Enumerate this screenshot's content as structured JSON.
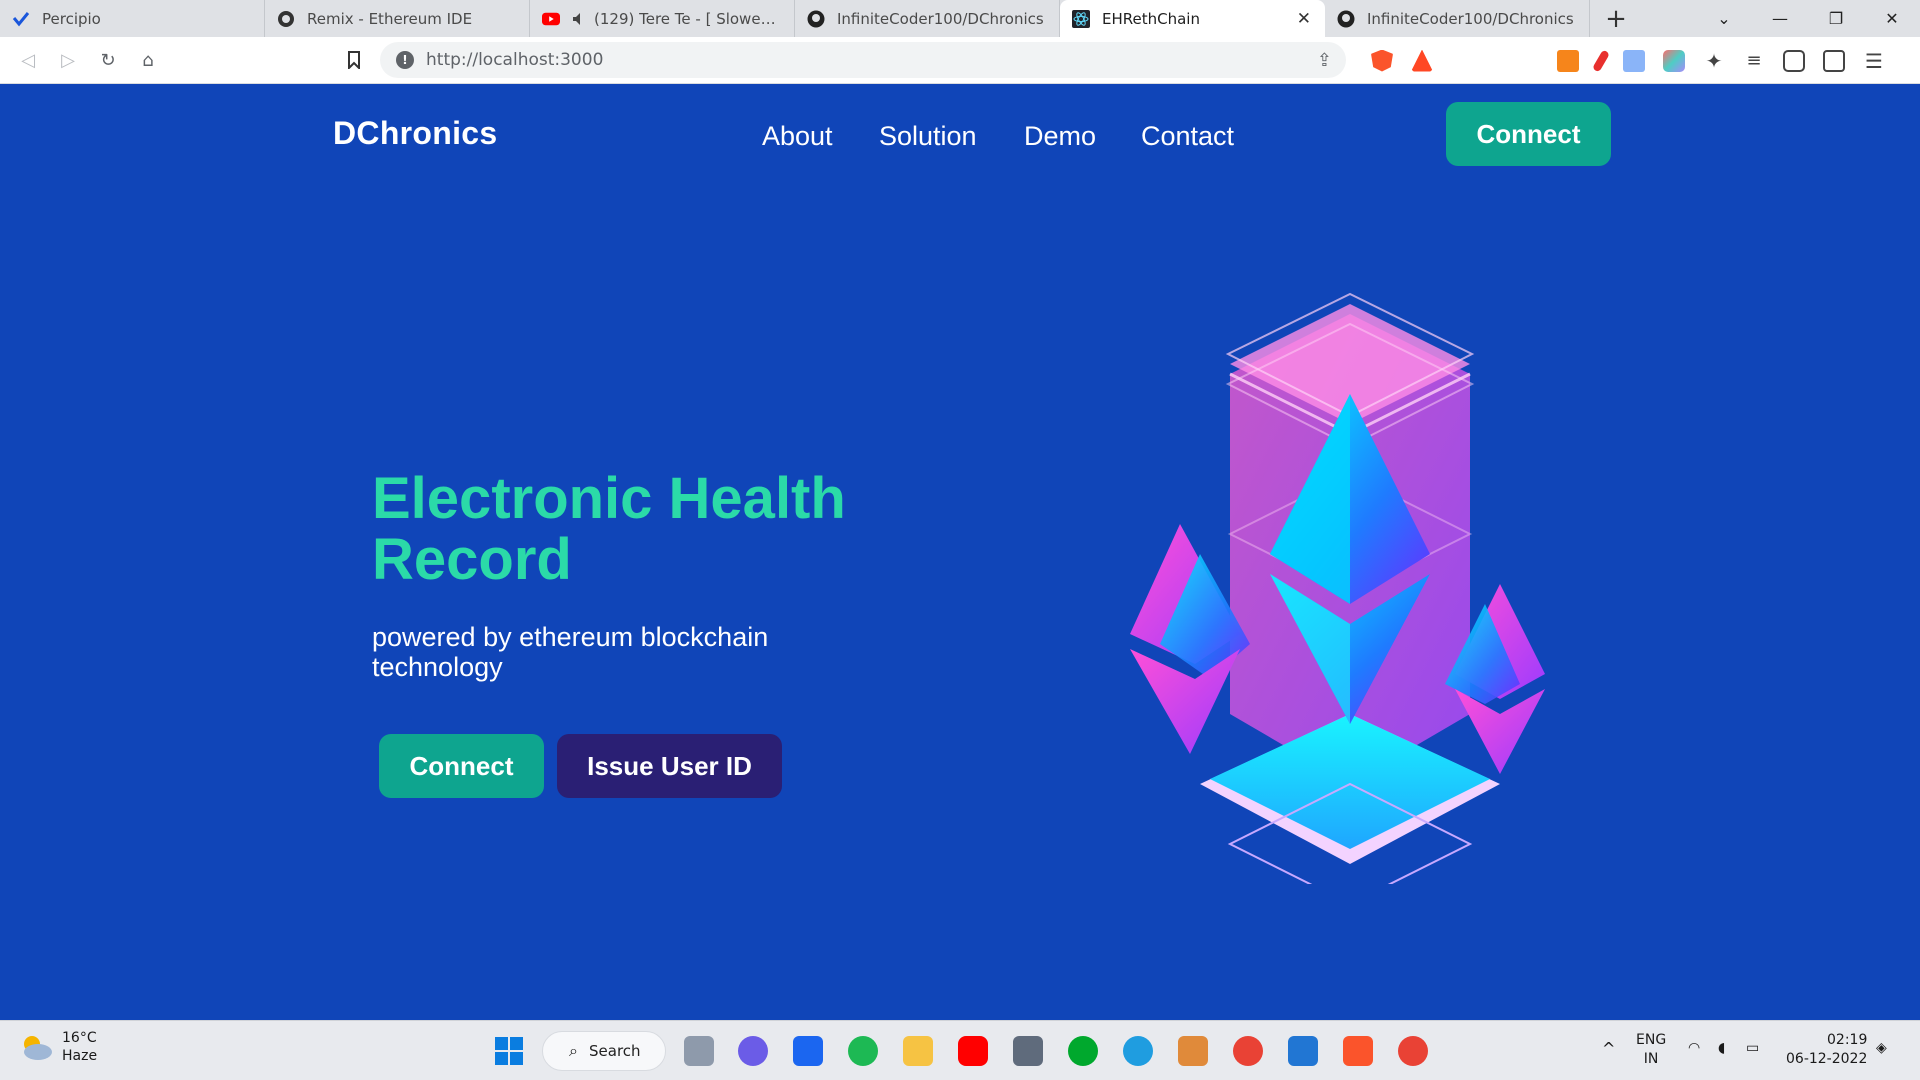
{
  "browser": {
    "tabs": [
      {
        "title": "Percipio",
        "icon": "percipio-icon",
        "active": false
      },
      {
        "title": "Remix - Ethereum IDE",
        "icon": "remix-icon",
        "active": false
      },
      {
        "title": "(129) Tere Te - [ Slowed + Re",
        "icon": "youtube-icon",
        "active": false
      },
      {
        "title": "InfiniteCoder100/DChronics",
        "icon": "github-icon",
        "active": false
      },
      {
        "title": "EHRethChain",
        "icon": "react-icon",
        "active": true
      },
      {
        "title": "InfiniteCoder100/DChronics",
        "icon": "github-icon",
        "active": false
      }
    ],
    "url": "http://localhost:3000",
    "colors": {
      "tabbar": "#dfe1e5",
      "addrbar": "#ffffff"
    }
  },
  "header": {
    "brand": "DChronics",
    "nav": [
      "About",
      "Solution",
      "Demo",
      "Contact"
    ],
    "connect_label": "Connect"
  },
  "hero": {
    "title": "Electronic Health Record",
    "subtitle": "powered by ethereum blockchain technology",
    "connect_label": "Connect",
    "issue_label": "Issue User ID",
    "illustration": "ethereum-crystal-illustration"
  },
  "colors": {
    "page_bg": "#1045b8",
    "accent": "#2bdaa8",
    "teal_button": "#0ea58f",
    "navy_button": "#2a1f74"
  },
  "taskbar": {
    "weather_temp": "16°C",
    "weather_desc": "Haze",
    "search_label": "Search",
    "lang_top": "ENG",
    "lang_bottom": "IN",
    "time": "02:19",
    "date": "06-12-2022"
  }
}
